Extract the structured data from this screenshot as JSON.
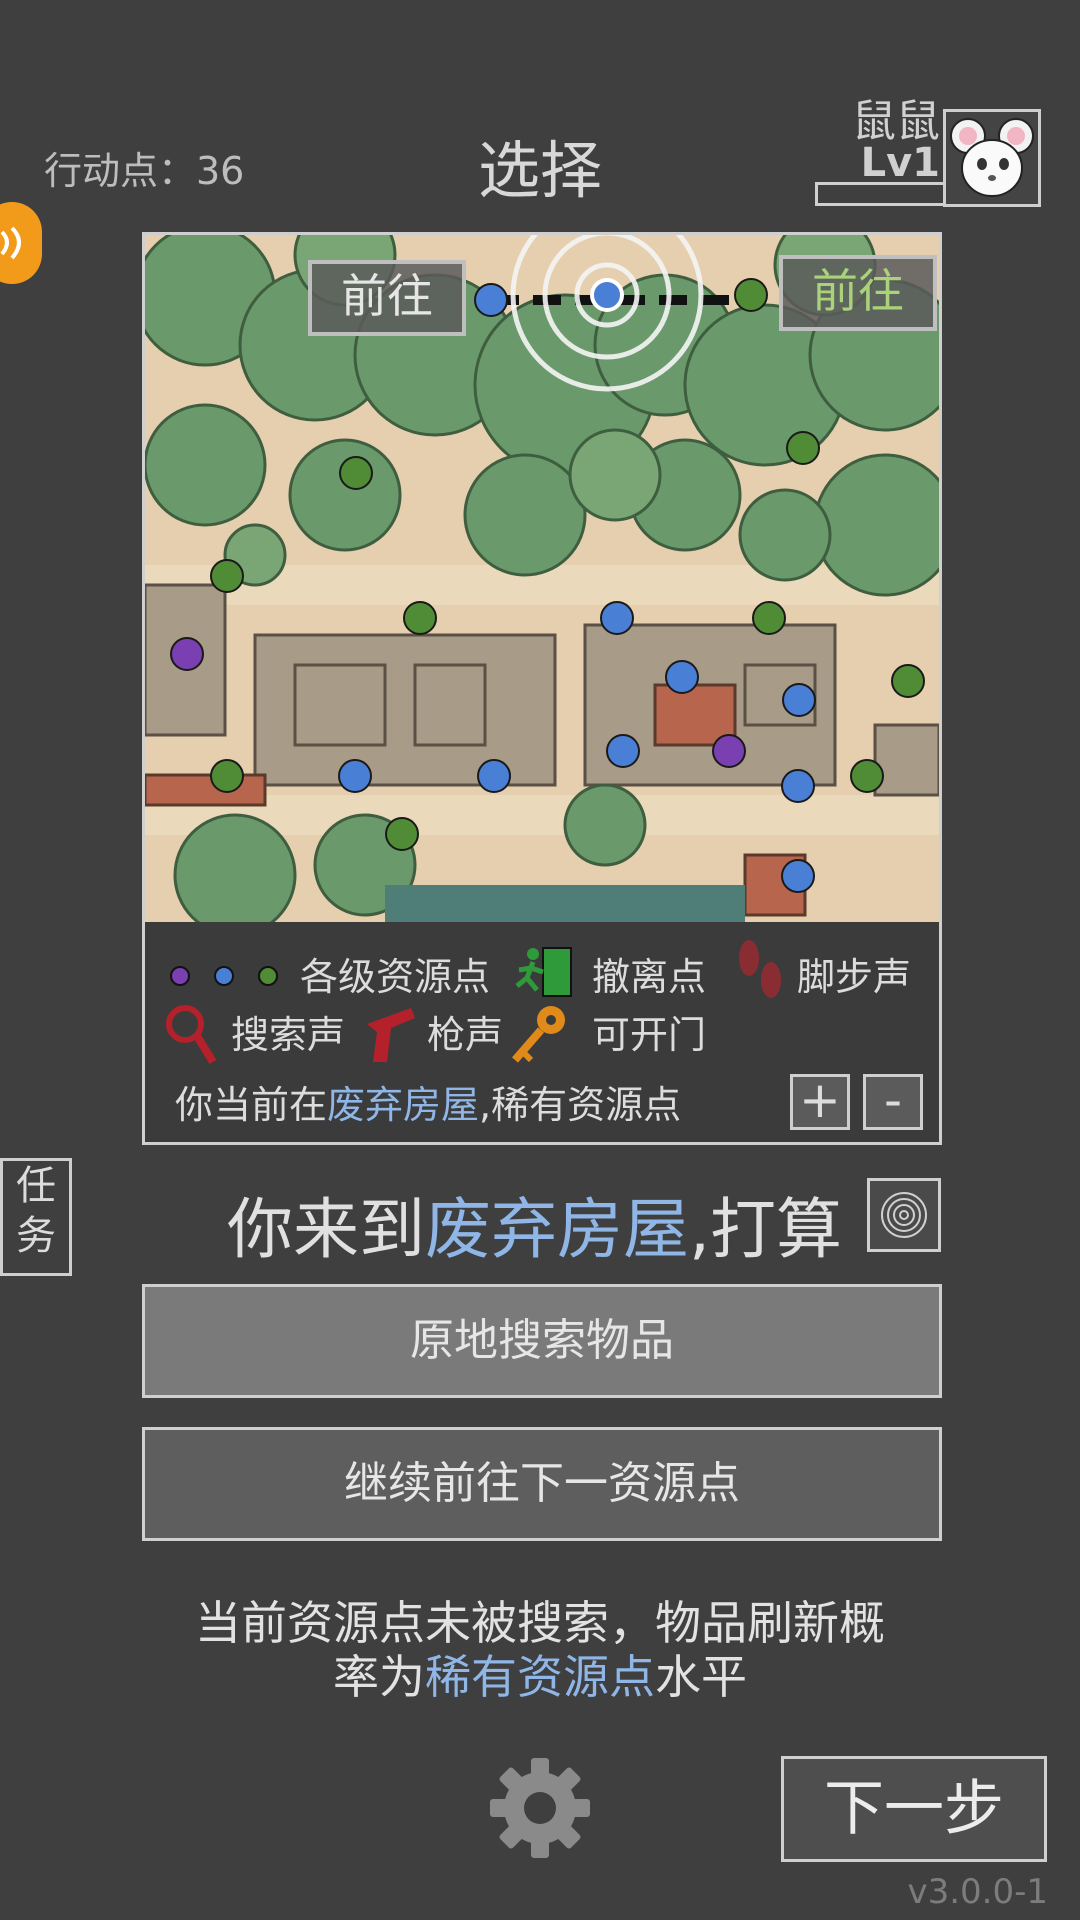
{
  "header": {
    "action_points": "行动点：36",
    "title": "选择",
    "player_name": "鼠鼠",
    "player_level": "Lv1"
  },
  "map": {
    "goto_left": "前往",
    "goto_right": "前往"
  },
  "legend": {
    "resource": "各级资源点",
    "evacuation": "撤离点",
    "footsteps": "脚步声",
    "search_sound": "搜索声",
    "gunshot": "枪声",
    "openable_door": "可开门",
    "location_prefix": "你当前在",
    "location_name": "废弃房屋",
    "location_suffix": ",稀有资源点",
    "zoom_in": "+",
    "zoom_out": "-"
  },
  "side": {
    "task": "任务"
  },
  "event": {
    "prefix": "你来到",
    "place": "废弃房屋",
    "suffix": ",打算"
  },
  "actions": {
    "search": "原地搜索物品",
    "continue": "继续前往下一资源点"
  },
  "note": {
    "line1": "当前资源点未被搜索，物品刷新概",
    "line2_prefix": "率为",
    "line2_highlight": "稀有资源点",
    "line2_suffix": "水平"
  },
  "footer": {
    "next": "下一步",
    "version": "v3.0.0-1"
  },
  "colors": {
    "purple_point": "#7a3fb0",
    "blue_point": "#4a7fd6",
    "green_point": "#4f8c35",
    "highlight": "#8fb6e6"
  }
}
